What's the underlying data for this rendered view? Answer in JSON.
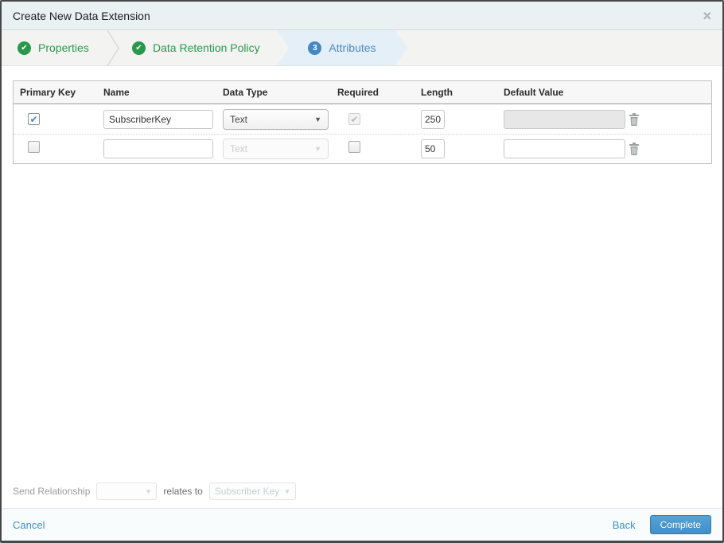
{
  "modal": {
    "title": "Create New Data Extension",
    "close_glyph": "×"
  },
  "wizard": {
    "steps": [
      {
        "label": "Properties",
        "state": "complete"
      },
      {
        "label": "Data Retention Policy",
        "state": "complete"
      },
      {
        "label": "Attributes",
        "state": "current",
        "number": "3"
      }
    ]
  },
  "table": {
    "headers": {
      "primary_key": "Primary Key",
      "name": "Name",
      "data_type": "Data Type",
      "required": "Required",
      "length": "Length",
      "default_value": "Default Value"
    },
    "rows": [
      {
        "primary_key": true,
        "name": "SubscriberKey",
        "data_type": "Text",
        "data_type_disabled": false,
        "required": true,
        "required_disabled": true,
        "length": "250",
        "default_value": "",
        "default_value_disabled": true
      },
      {
        "primary_key": false,
        "name": "",
        "data_type": "Text",
        "data_type_disabled": true,
        "required": false,
        "required_disabled": false,
        "length": "50",
        "default_value": "",
        "default_value_disabled": false
      }
    ]
  },
  "relationship": {
    "send_label": "Send Relationship",
    "field_value": "",
    "relates_label": "relates to",
    "target_value": "Subscriber Key",
    "caret_glyph": "▼"
  },
  "footer": {
    "cancel": "Cancel",
    "back": "Back",
    "complete": "Complete"
  },
  "colors": {
    "step_complete_green": "#28984a",
    "step_current_blue": "#4288c6",
    "active_step_bg": "#e5eff7",
    "primary_button_blue": "#448fc7",
    "link_blue": "#3f8fc9",
    "titlebar_bg": "#eaf1f3"
  }
}
